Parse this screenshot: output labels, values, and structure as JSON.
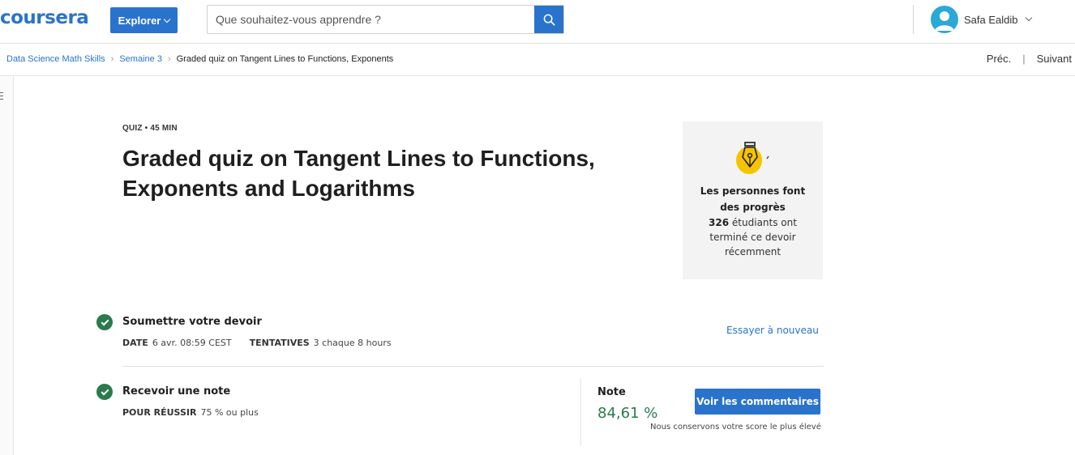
{
  "header": {
    "logo_text": "coursera",
    "explore_label": "Explorer",
    "search_placeholder": "Que souhaitez-vous apprendre ?",
    "user_name": "Safa Ealdib"
  },
  "breadcrumb": {
    "items": [
      "Data Science Math Skills",
      "Semaine 3"
    ],
    "current": "Graded quiz on Tangent Lines to Functions, Exponents"
  },
  "nav": {
    "prev_label": "Préc.",
    "next_label": "Suivant"
  },
  "quiz": {
    "meta": "QUIZ • 45  MIN",
    "title": "Graded quiz on Tangent Lines to Functions, Exponents and Logarithms"
  },
  "progress_card": {
    "heading": "Les personnes font des progrès",
    "count": "326",
    "body_rest": "étudiants ont terminé ce devoir récemment"
  },
  "submit_step": {
    "title": "Soumettre votre devoir",
    "date_key": "DATE",
    "date_value": "6 avr. 08:59 CEST",
    "attempts_key": "TENTATIVES",
    "attempts_value": "3 chaque 8  hours",
    "retry_label": "Essayer à nouveau"
  },
  "grade_step": {
    "title": "Recevoir une note",
    "pass_key": "POUR RÉUSSIR",
    "pass_value": "75 % ou plus",
    "grade_label": "Note",
    "grade_value": "84,61 %",
    "feedback_label": "Voir les commentaires",
    "keep_note": "Nous conservons votre score le plus élevé"
  },
  "colors": {
    "brand": "#2a73cc",
    "success": "#2b7a4b",
    "card_bg": "#f3f3f3"
  }
}
